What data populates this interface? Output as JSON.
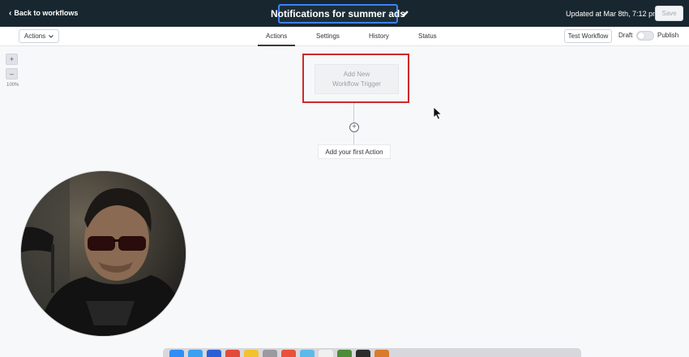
{
  "topbar": {
    "back_label": "Back to workflows",
    "workflow_title": "Notifications for summer ads",
    "updated_text": "Updated at Mar 8th, 7:12 pm",
    "save_label": "Save"
  },
  "subbar": {
    "actions_dropdown_label": "Actions",
    "tabs": [
      {
        "label": "Actions",
        "active": true
      },
      {
        "label": "Settings",
        "active": false
      },
      {
        "label": "History",
        "active": false
      },
      {
        "label": "Status",
        "active": false
      }
    ],
    "test_workflow_label": "Test Workflow",
    "draft_label": "Draft",
    "publish_label": "Publish",
    "published": false
  },
  "zoom": {
    "zoom_in_symbol": "+",
    "zoom_out_symbol": "–",
    "level": "100%"
  },
  "canvas": {
    "trigger_line1": "Add New",
    "trigger_line2": "Workflow Trigger",
    "add_action_symbol": "+",
    "first_action_label": "Add your first Action"
  },
  "colors": {
    "topbar_bg": "#18272f",
    "title_border": "#3b82f6",
    "highlight_red": "#cc2a2a"
  },
  "icons": {
    "back": "chevron-left-icon",
    "edit": "pencil-icon",
    "dropdown": "chevron-down-icon",
    "add": "plus-circle-icon",
    "pointer": "mouse-pointer-icon"
  }
}
